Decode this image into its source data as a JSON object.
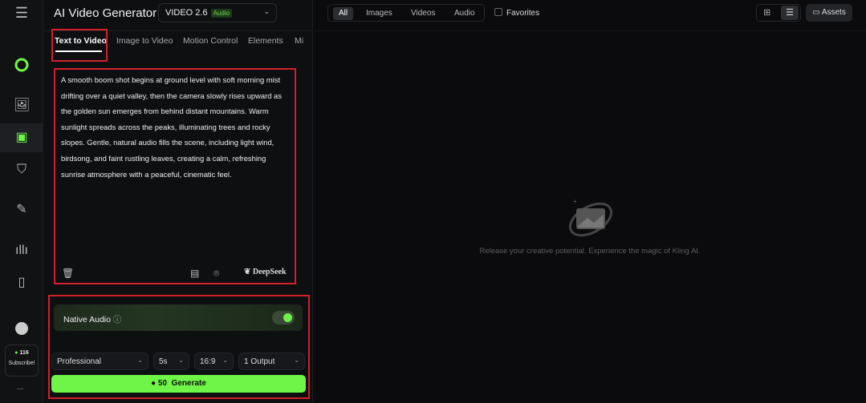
{
  "sidebar": {
    "credits": "116",
    "subscribe": "Subscribe!",
    "more": "..."
  },
  "header": {
    "title": "AI Video Generator",
    "model": "VIDEO 2.6",
    "model_badge": "Audio"
  },
  "tabs": [
    "Text to Video",
    "Image to Video",
    "Motion Control",
    "Elements",
    "Mi"
  ],
  "prompt": {
    "text": "A smooth boom shot begins at ground level with soft morning mist drifting over a quiet valley, then the camera slowly rises upward as the golden sun emerges from behind distant mountains. Warm sunlight spreads across the peaks, illuminating trees and rocky slopes. Gentle, natural audio fills the scene, including light wind, birdsong, and faint rustling leaves, creating a calm, refreshing sunrise atmosphere with a peaceful, cinematic feel.",
    "deepseek": "DeepSeek"
  },
  "settings": {
    "native_audio": "Native Audio",
    "native_audio_on": true,
    "mode": "Professional",
    "duration": "5s",
    "ratio": "16:9",
    "outputs": "1 Output",
    "cost": "50",
    "generate": "Generate"
  },
  "filters": {
    "items": [
      "All",
      "Images",
      "Videos",
      "Audio"
    ],
    "active": "All",
    "favorites": "Favorites",
    "assets": "Assets"
  },
  "empty_state": "Release your creative potential. Experience the magic of Kling AI.",
  "colors": {
    "accent": "#6ef548",
    "highlight": "#d21f2a"
  }
}
